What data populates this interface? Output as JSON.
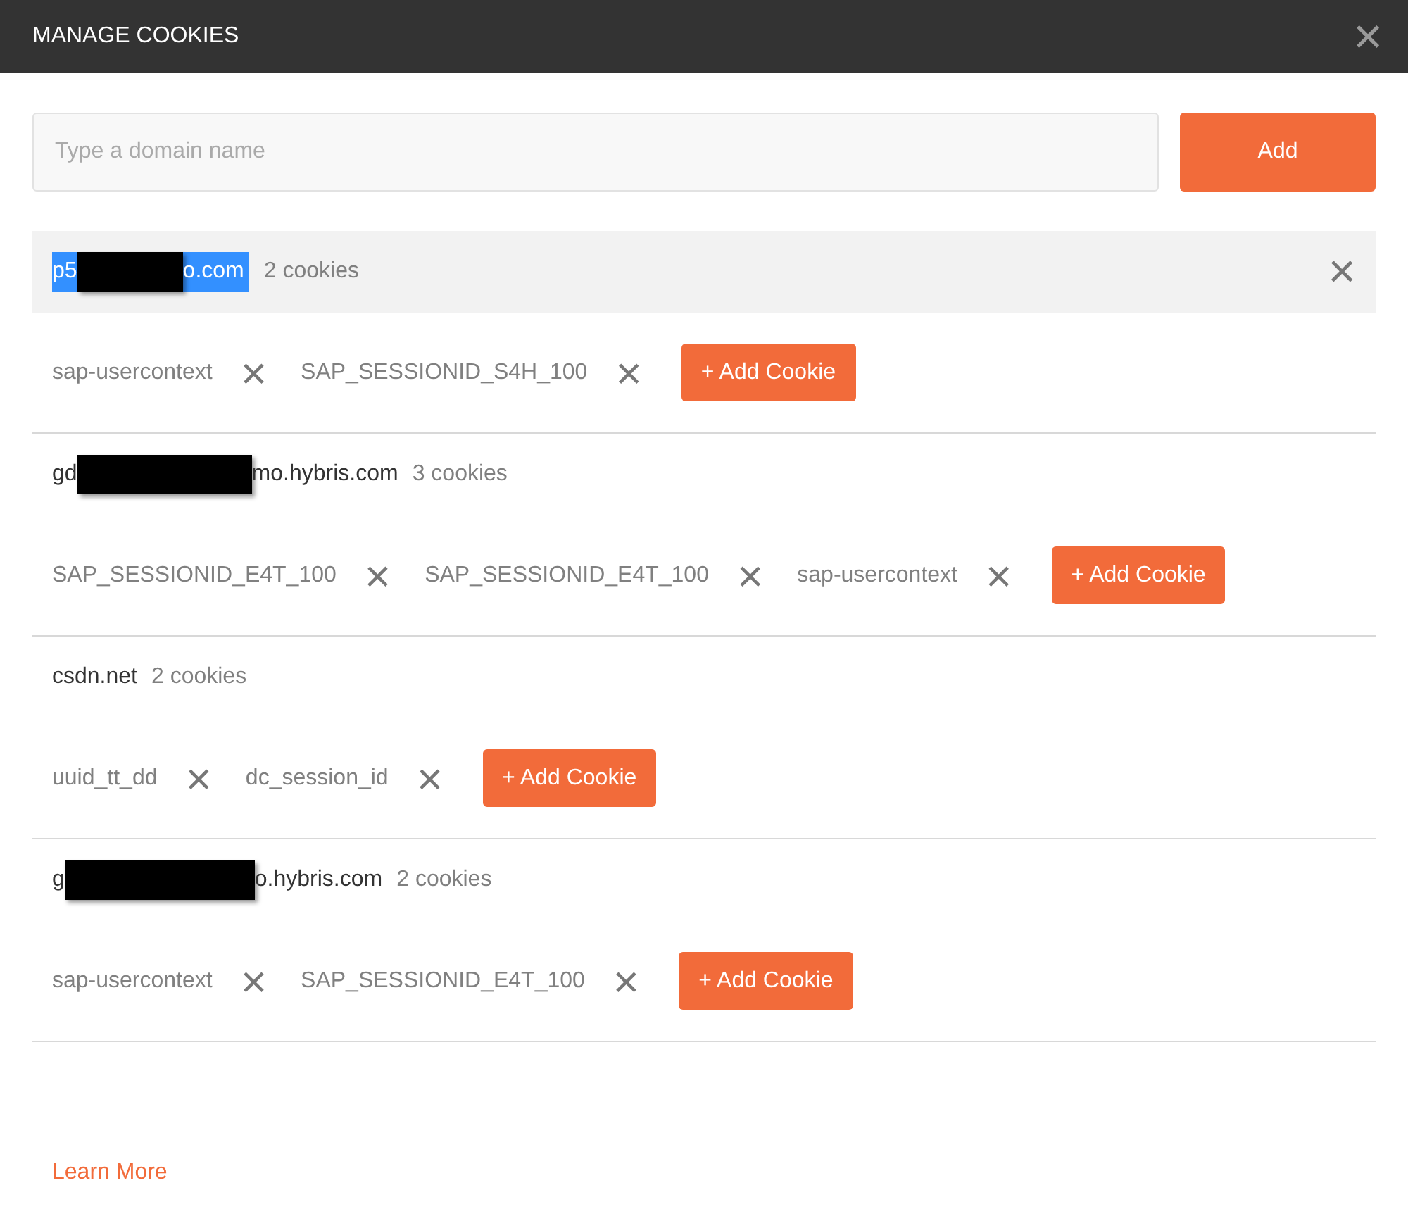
{
  "window": {
    "title": "MANAGE COOKIES",
    "close": "×"
  },
  "domain_field": {
    "placeholder": "Type a domain name"
  },
  "add_button": "Add",
  "domains": [
    {
      "name_start": "p5",
      "name_end": "o.com",
      "text_highlighted": true,
      "selected": true,
      "count": "2 cookies",
      "remove": "×",
      "cookies": [
        {
          "name": "sap-usercontext",
          "remove": "×"
        },
        {
          "name": "SAP_SESSIONID_S4H_100",
          "remove": "×"
        }
      ],
      "add_cookie": "+ Add Cookie"
    },
    {
      "name_start": "gd",
      "name_end": "mo.hybris.com",
      "text_highlighted": false,
      "selected": false,
      "count": "3 cookies",
      "cookies": [
        {
          "name": "SAP_SESSIONID_E4T_100",
          "remove": "×"
        },
        {
          "name": "SAP_SESSIONID_E4T_100",
          "remove": "×"
        },
        {
          "name": "sap-usercontext",
          "remove": "×"
        }
      ],
      "add_cookie": "+ Add Cookie"
    },
    {
      "name_start": "csdn.net",
      "text_highlighted": false,
      "selected": false,
      "count": "2 cookies",
      "cookies": [
        {
          "name": "uuid_tt_dd",
          "remove": "×"
        },
        {
          "name": "dc_session_id",
          "remove": "×"
        }
      ],
      "add_cookie": "+ Add Cookie"
    },
    {
      "name_start": "g",
      "name_end": "o.hybris.com",
      "text_highlighted": false,
      "selected": false,
      "count": "2 cookies",
      "cookies": [
        {
          "name": "sap-usercontext",
          "remove": "×"
        },
        {
          "name": "SAP_SESSIONID_E4T_100",
          "remove": "×"
        }
      ],
      "add_cookie": "+ Add Cookie"
    }
  ],
  "learn_more": "Learn More"
}
